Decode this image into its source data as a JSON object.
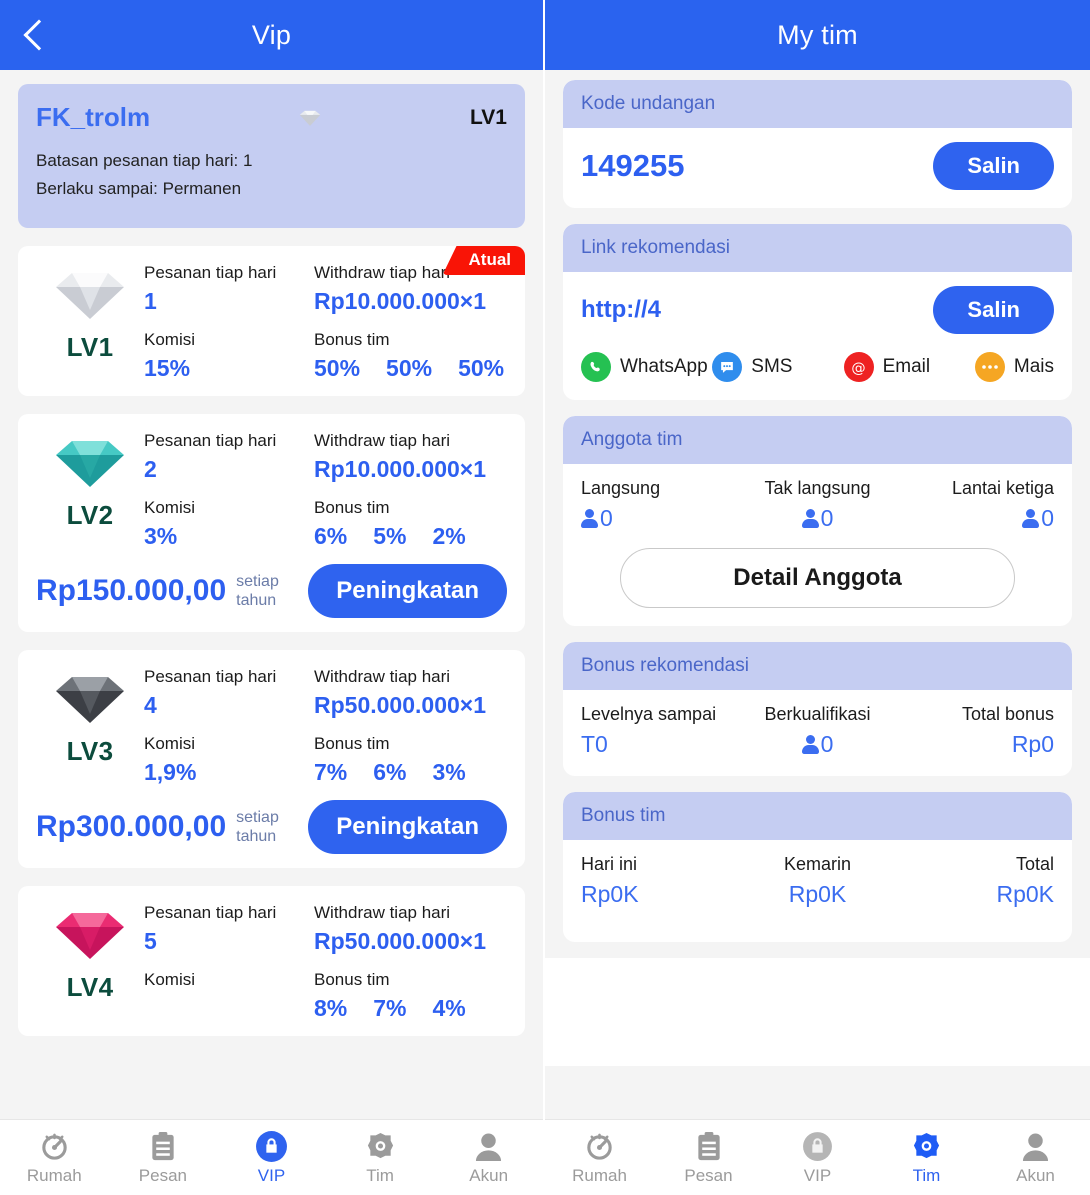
{
  "left": {
    "header": {
      "title": "Vip",
      "back_icon": "chevron-left-icon"
    },
    "profile": {
      "username": "FK_trolm",
      "level": "LV1",
      "line1": "Batasan pesanan tiap hari: 1",
      "line2": "Berlaku sampai: Permanen"
    },
    "labels": {
      "orders_per_day": "Pesanan tiap hari",
      "commission": "Komisi",
      "withdraw_per_day": "Withdraw tiap hari",
      "team_bonus": "Bonus tim",
      "per_year": "setiap tahun",
      "upgrade": "Peningkatan",
      "current_badge": "Atual"
    },
    "levels": [
      {
        "name": "LV1",
        "diamond_color": "silver",
        "orders": "1",
        "commission": "15%",
        "withdraw": "Rp10.000.000×1",
        "bonus": [
          "50%",
          "50%",
          "50%"
        ],
        "price": "",
        "is_current": true
      },
      {
        "name": "LV2",
        "diamond_color": "teal",
        "orders": "2",
        "commission": "3%",
        "withdraw": "Rp10.000.000×1",
        "bonus": [
          "6%",
          "5%",
          "2%"
        ],
        "price": "Rp150.000,00",
        "is_current": false
      },
      {
        "name": "LV3",
        "diamond_color": "black",
        "orders": "4",
        "commission": "1,9%",
        "withdraw": "Rp50.000.000×1",
        "bonus": [
          "7%",
          "6%",
          "3%"
        ],
        "price": "Rp300.000,00",
        "is_current": false
      },
      {
        "name": "LV4",
        "diamond_color": "pink",
        "orders": "5",
        "commission": "",
        "withdraw": "Rp50.000.000×1",
        "bonus": [
          "8%",
          "7%",
          "4%"
        ],
        "price": "",
        "is_current": false
      }
    ],
    "tabs": [
      {
        "label": "Rumah",
        "icon": "speedometer-icon",
        "active": false
      },
      {
        "label": "Pesan",
        "icon": "clipboard-icon",
        "active": false
      },
      {
        "label": "VIP",
        "icon": "bag-lock-icon",
        "active": true
      },
      {
        "label": "Tim",
        "icon": "gear-icon",
        "active": false
      },
      {
        "label": "Akun",
        "icon": "person-icon",
        "active": false
      }
    ]
  },
  "right": {
    "header": {
      "title": "My tim"
    },
    "invite": {
      "card_title": "Kode undangan",
      "code": "149255",
      "copy_label": "Salin"
    },
    "link": {
      "card_title": "Link rekomendasi",
      "url": "http://4",
      "copy_label": "Salin",
      "share": [
        {
          "label": "WhatsApp",
          "icon": "whatsapp-icon",
          "color": "#25c152"
        },
        {
          "label": "SMS",
          "icon": "sms-bubble-icon",
          "color": "#2f8ded"
        },
        {
          "label": "Email",
          "icon": "at-email-icon",
          "color": "#ee2222"
        },
        {
          "label": "Mais",
          "icon": "more-dots-icon",
          "color": "#f5a623"
        }
      ]
    },
    "members": {
      "card_title": "Anggota tim",
      "stats": [
        {
          "label": "Langsung",
          "value": "0",
          "icon": "person-icon"
        },
        {
          "label": "Tak langsung",
          "value": "0",
          "icon": "person-icon"
        },
        {
          "label": "Lantai ketiga",
          "value": "0",
          "icon": "person-icon"
        }
      ],
      "detail_button": "Detail Anggota"
    },
    "referral_bonus": {
      "card_title": "Bonus rekomendasi",
      "stats": [
        {
          "label": "Levelnya sampai",
          "value": "T0",
          "icon": ""
        },
        {
          "label": "Berkualifikasi",
          "value": "0",
          "icon": "person-icon"
        },
        {
          "label": "Total bonus",
          "value": "Rp0",
          "icon": ""
        }
      ]
    },
    "team_bonus": {
      "card_title": "Bonus tim",
      "stats": [
        {
          "label": "Hari ini",
          "value": "Rp0K",
          "icon": ""
        },
        {
          "label": "Kemarin",
          "value": "Rp0K",
          "icon": ""
        },
        {
          "label": "Total",
          "value": "Rp0K",
          "icon": ""
        }
      ]
    },
    "tabs": [
      {
        "label": "Rumah",
        "icon": "speedometer-icon",
        "active": false
      },
      {
        "label": "Pesan",
        "icon": "clipboard-icon",
        "active": false
      },
      {
        "label": "VIP",
        "icon": "bag-lock-icon",
        "active": false
      },
      {
        "label": "Tim",
        "icon": "gear-icon",
        "active": true
      },
      {
        "label": "Akun",
        "icon": "person-icon",
        "active": false
      }
    ]
  },
  "colors": {
    "brand_blue": "#2a63ef",
    "accent_text": "#2d5ff0",
    "header_band": "#c5cdf2",
    "badge_red": "#f91406",
    "level_name": "#0c4c3d"
  }
}
